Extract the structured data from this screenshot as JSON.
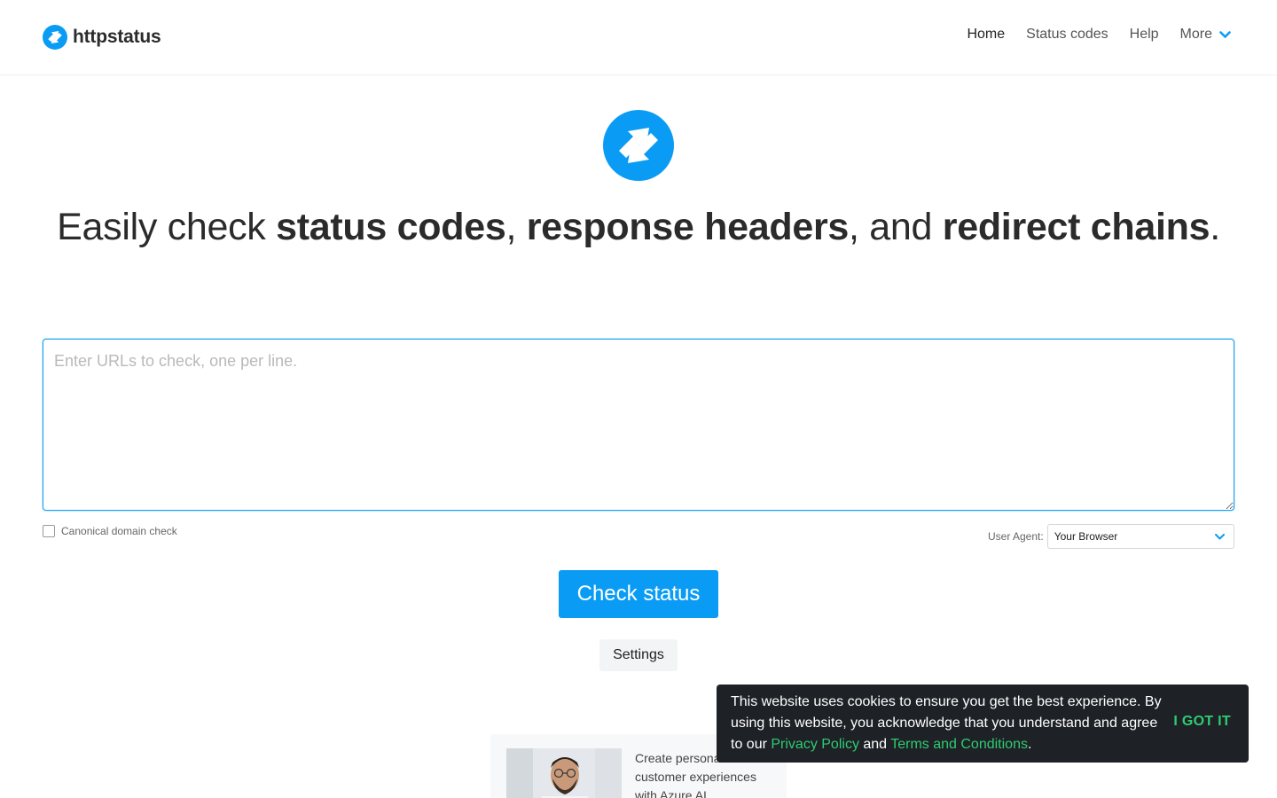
{
  "header": {
    "brand": {
      "name": "httpstatus",
      "icon": "arrows-logo-icon"
    },
    "nav": [
      {
        "label": "Home",
        "active": true
      },
      {
        "label": "Status codes",
        "active": false
      },
      {
        "label": "Help",
        "active": false
      },
      {
        "label": "More",
        "active": false,
        "icon": "chevron-down-icon"
      }
    ]
  },
  "hero": {
    "logo_icon": "arrows-logo-icon",
    "headline": {
      "prefix": "Easily check ",
      "bold1": "status codes",
      "sep1": ", ",
      "bold2": "response headers",
      "sep2": ", and ",
      "bold3": "redirect chains",
      "suffix": "."
    }
  },
  "form": {
    "url_input": {
      "value": "",
      "placeholder": "Enter URLs to check, one per line."
    },
    "canonical_check": {
      "label": "Canonical domain check",
      "checked": false
    },
    "user_agent": {
      "label": "User Agent:",
      "selected": "Your Browser"
    },
    "submit_label": "Check status",
    "settings_label": "Settings"
  },
  "ad": {
    "text": "Create personalized customer experiences with Azure AI."
  },
  "cookie_banner": {
    "text_part1": "This website uses cookies to ensure you get the best experience. By using this website, you acknowledge that you understand and agree to our ",
    "privacy_link": "Privacy Policy",
    "and": " and ",
    "terms_link": "Terms and Conditions",
    "period": ".",
    "accept_label": "I GOT IT"
  },
  "colors": {
    "brand_blue": "#0a9cf5",
    "cookie_bg": "#1e2126",
    "cookie_accent": "#2ecc71",
    "text_dark": "#2b2b2b"
  }
}
